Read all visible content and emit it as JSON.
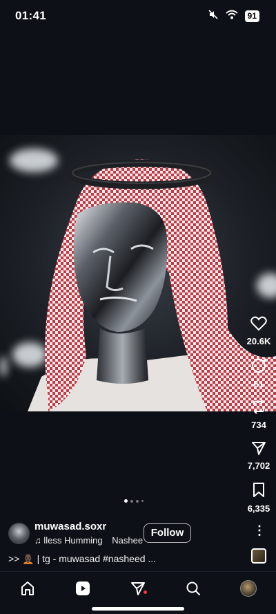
{
  "status_bar": {
    "time": "01:41",
    "battery": "91",
    "icons": [
      "mute-icon",
      "wifi-icon",
      "battery-icon"
    ]
  },
  "post": {
    "image_description_icon": "chrome-mask-figure-image",
    "actions": {
      "likes": "20.6K",
      "comments": "61",
      "reposts": "734",
      "shares": "7,702",
      "saves": "6,335"
    },
    "carousel": {
      "count": 4,
      "active_index": 0
    },
    "author": {
      "username": "muwasad.soxr",
      "follow_label": "Follow"
    },
    "audio": {
      "parts": [
        "lless Humming",
        "Nashee"
      ]
    },
    "caption": ">> 🧑🏿‍🦲 | tg - muwasad #nasheed ..."
  },
  "nav": {
    "items": [
      "home-icon",
      "reels-icon",
      "direct-icon",
      "search-icon",
      "profile-icon"
    ],
    "notification_color": "#ff3040"
  },
  "colors": {
    "background": "#0d1117",
    "text": "#ffffff"
  }
}
